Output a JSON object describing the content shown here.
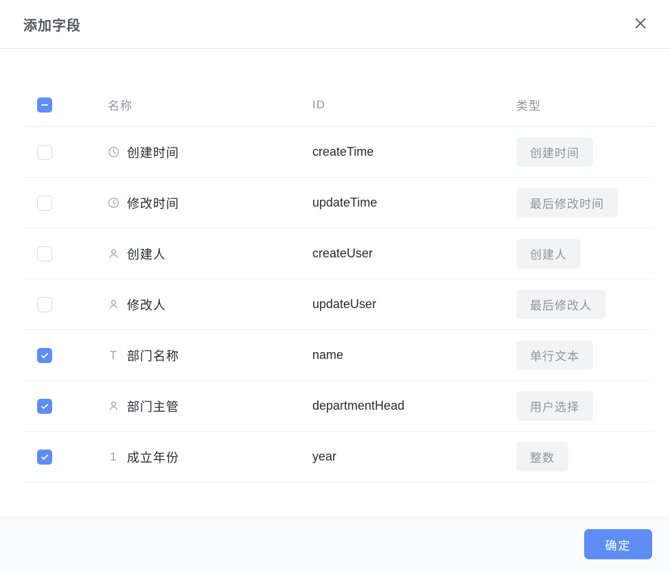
{
  "dialog": {
    "title": "添加字段",
    "confirm_label": "确定"
  },
  "table": {
    "headers": {
      "name": "名称",
      "id": "ID",
      "type": "类型"
    },
    "header_checkbox_state": "indeterminate",
    "rows": [
      {
        "checked": false,
        "icon": "clock",
        "name": "创建时间",
        "id": "createTime",
        "type": "创建时间"
      },
      {
        "checked": false,
        "icon": "clock",
        "name": "修改时间",
        "id": "updateTime",
        "type": "最后修改时间"
      },
      {
        "checked": false,
        "icon": "user",
        "name": "创建人",
        "id": "createUser",
        "type": "创建人"
      },
      {
        "checked": false,
        "icon": "user",
        "name": "修改人",
        "id": "updateUser",
        "type": "最后修改人"
      },
      {
        "checked": true,
        "icon": "text",
        "name": "部门名称",
        "id": "name",
        "type": "单行文本"
      },
      {
        "checked": true,
        "icon": "user",
        "name": "部门主管",
        "id": "departmentHead",
        "type": "用户选择"
      },
      {
        "checked": true,
        "icon": "number",
        "name": "成立年份",
        "id": "year",
        "type": "整数"
      }
    ]
  },
  "colors": {
    "accent_blue": "#5e8df6",
    "badge_bg": "#f2f3f5",
    "muted_text": "#8f959e"
  }
}
